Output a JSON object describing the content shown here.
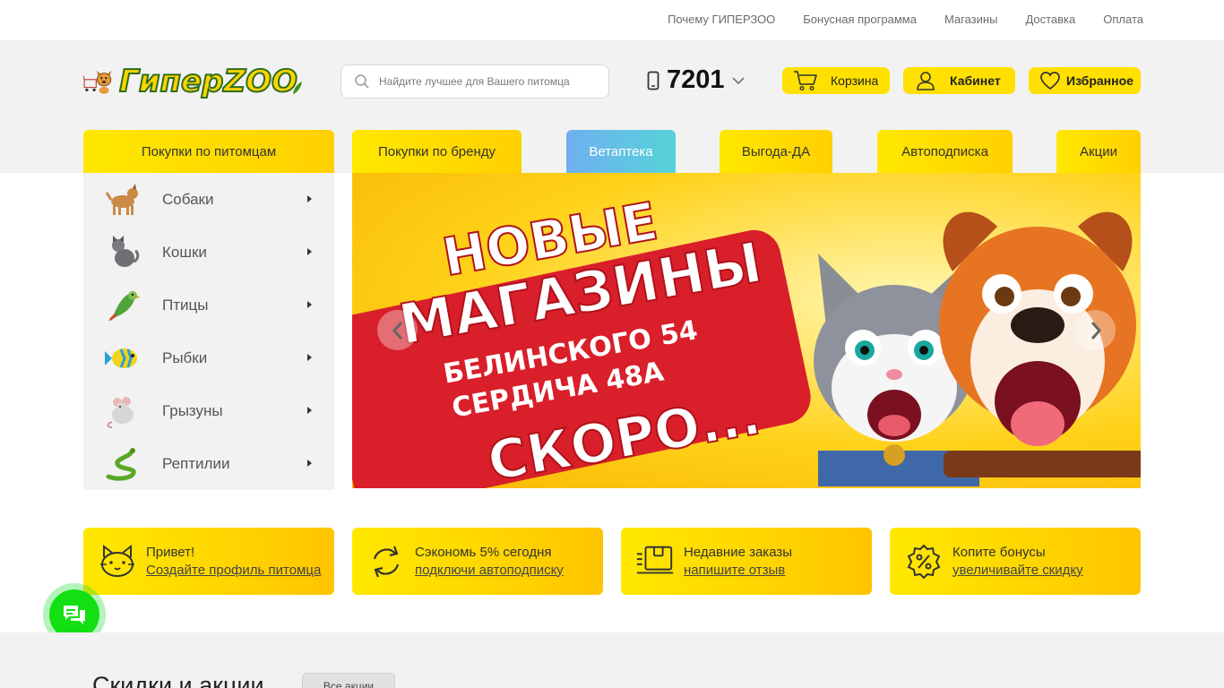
{
  "topnav": [
    "Почему ГИПЕРЗОО",
    "Бонусная программа",
    "Магазины",
    "Доставка",
    "Оплата"
  ],
  "logo": {
    "text": "ГиперZOO"
  },
  "search": {
    "placeholder": "Найдите лучшее для Вашего питомца"
  },
  "phone": {
    "number": "7201"
  },
  "header_buttons": {
    "cart": "Корзина",
    "cabinet": "Кабинет",
    "favorites": "Избранное"
  },
  "tabs": [
    "Покупки по питомцам",
    "Покупки по бренду",
    "Ветаптека",
    "Выгода-ДА",
    "Автоподписка",
    "Акции"
  ],
  "categories": [
    "Собаки",
    "Кошки",
    "Птицы",
    "Рыбки",
    "Грызуны",
    "Рептилии"
  ],
  "banner": {
    "line1": "НОВЫЕ",
    "line2": "МАГАЗИНЫ",
    "line3": "БЕЛИНСКОГО 54",
    "line4": "СЕРДИЧА 48А",
    "line5": "СКОРО..."
  },
  "promos": [
    {
      "title": "Привет!",
      "link": "Создайте профиль питомца"
    },
    {
      "title": "Сэкономь 5% сегодня",
      "link": "подключи автоподписку"
    },
    {
      "title": "Недавние заказы",
      "link": "напишите отзыв"
    },
    {
      "title": "Копите бонусы",
      "link": "увеличивайте скидку"
    }
  ],
  "sales": {
    "title": "Скидки и акции",
    "all_button": "Все акции"
  },
  "colors": {
    "accent_yellow": "#ffe000",
    "vet_blue": "#6fb0f0",
    "chat_green": "#12e012",
    "banner_red": "#d81f2a"
  }
}
